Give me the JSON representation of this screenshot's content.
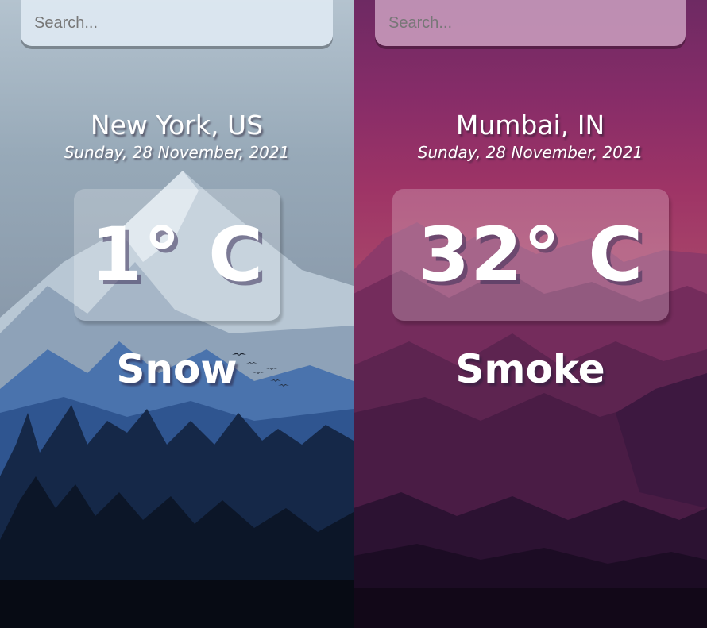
{
  "panels": [
    {
      "search": {
        "placeholder": "Search..."
      },
      "location": "New York, US",
      "date": "Sunday, 28 November, 2021",
      "temperature": "1° C",
      "condition": "Snow",
      "theme": {
        "sky": "#9aaab7",
        "mountain": "#3d6aa8",
        "forest": "#0d1a30"
      }
    },
    {
      "search": {
        "placeholder": "Search..."
      },
      "location": "Mumbai, IN",
      "date": "Sunday, 28 November, 2021",
      "temperature": "32° C",
      "condition": "Smoke",
      "theme": {
        "sky": "#8a2f6a",
        "mountain": "#7a2d5c",
        "forest": "#1a0f26"
      }
    }
  ]
}
